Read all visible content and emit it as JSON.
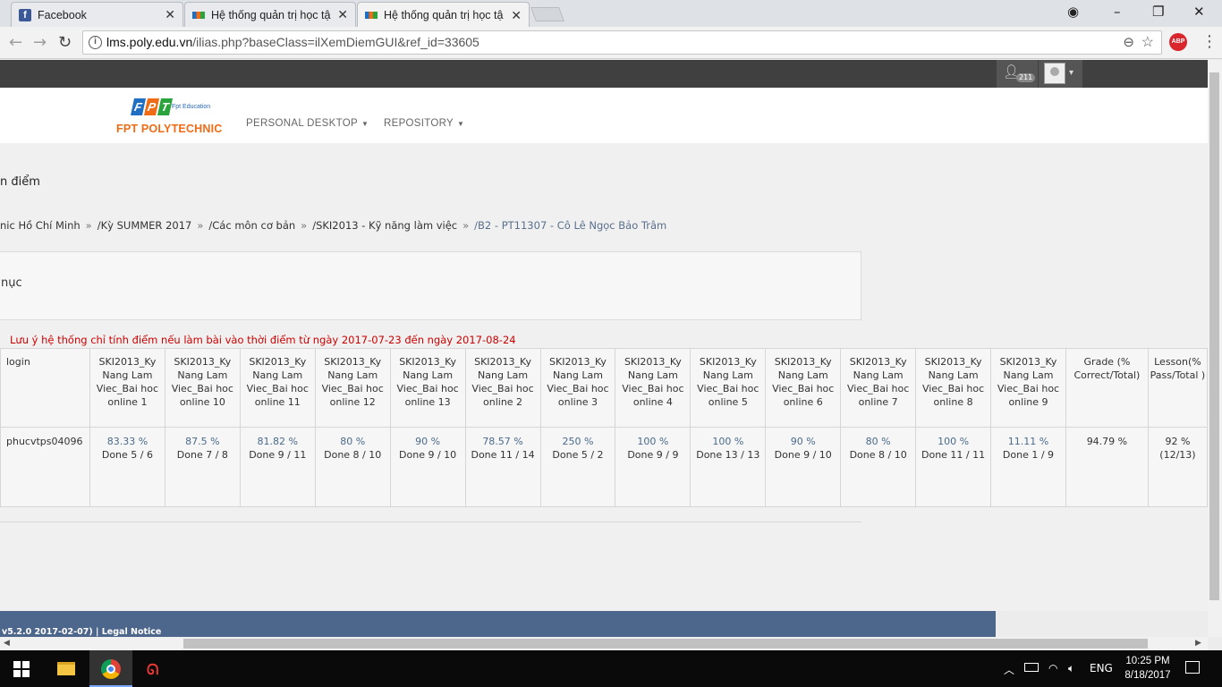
{
  "browser": {
    "tabs": [
      {
        "title": "Facebook",
        "icon": "facebook-icon",
        "active": false
      },
      {
        "title": "Hệ thống quản trị học tậ",
        "icon": "fpt-icon",
        "active": false
      },
      {
        "title": "Hệ thống quản trị học tậ",
        "icon": "fpt-icon",
        "active": true
      }
    ],
    "tab_close": "✕",
    "window_controls": {
      "profile": "◉",
      "minimize": "–",
      "restore": "❐",
      "close": "✕"
    },
    "nav": {
      "back": "←",
      "forward": "→",
      "reload": "↻"
    },
    "url_host": "lms.poly.edu.vn",
    "url_path": "/ilias.php?baseClass=ilXemDiemGUI&ref_id=33605",
    "zoom_icon": "⊖",
    "star_icon": "☆",
    "abp_label": "ABP",
    "menu": "⋮"
  },
  "topbar": {
    "user_count": "211",
    "caret": "▾"
  },
  "header": {
    "logo_letters": [
      "F",
      "P",
      "T"
    ],
    "logo_colors": [
      "#1e6fc4",
      "#ef6b15",
      "#2aa33c"
    ],
    "logo_edu": "Fpt Education",
    "logo_brand": "FPT POLYTECHNIC",
    "nav": [
      {
        "label": "PERSONAL DESKTOP"
      },
      {
        "label": "REPOSITORY"
      }
    ]
  },
  "page": {
    "title": "n điểm",
    "breadcrumb": [
      "nic Hồ Chí Minh",
      "/Kỳ SUMMER 2017",
      "/Các môn cơ bản",
      "/SKI2013 - Kỹ năng làm việc",
      "/B2 - PT11307 - Cô Lê Ngọc Bảo Trâm"
    ],
    "breadcrumb_sep": "»",
    "box_title": "nục",
    "notice": "Lưu ý hệ thống chỉ tính điểm nếu làm bài vào thời điểm từ ngày 2017-07-23 đến ngày 2017-08-24"
  },
  "table": {
    "login_header": "login",
    "columns": [
      "SKI2013_Ky Nang Lam Viec_Bai hoc online 1",
      "SKI2013_Ky Nang Lam Viec_Bai hoc online 10",
      "SKI2013_Ky Nang Lam Viec_Bai hoc online 11",
      "SKI2013_Ky Nang Lam Viec_Bai hoc online 12",
      "SKI2013_Ky Nang Lam Viec_Bai hoc online 13",
      "SKI2013_Ky Nang Lam Viec_Bai hoc online 2",
      "SKI2013_Ky Nang Lam Viec_Bai hoc online 3",
      "SKI2013_Ky Nang Lam Viec_Bai hoc online 4",
      "SKI2013_Ky Nang Lam Viec_Bai hoc online 5",
      "SKI2013_Ky Nang Lam Viec_Bai hoc online 6",
      "SKI2013_Ky Nang Lam Viec_Bai hoc online 7",
      "SKI2013_Ky Nang Lam Viec_Bai hoc online 8",
      "SKI2013_Ky Nang Lam Viec_Bai hoc online 9",
      "Grade (% Correct/Total)",
      "Lesson(% Pass/Total )"
    ],
    "row": {
      "login": "phucvtps04096",
      "cells": [
        {
          "pct": "83.33 %",
          "done": "Done 5 / 6"
        },
        {
          "pct": "87.5 %",
          "done": "Done 7 / 8"
        },
        {
          "pct": "81.82 %",
          "done": "Done 9 / 11"
        },
        {
          "pct": "80 %",
          "done": "Done 8 / 10"
        },
        {
          "pct": "90 %",
          "done": "Done 9 / 10"
        },
        {
          "pct": "78.57 %",
          "done": "Done 11 / 14"
        },
        {
          "pct": "250 %",
          "done": "Done 5 / 2"
        },
        {
          "pct": "100 %",
          "done": "Done 9 / 9"
        },
        {
          "pct": "100 %",
          "done": "Done 13 / 13"
        },
        {
          "pct": "90 %",
          "done": "Done 9 / 10"
        },
        {
          "pct": "80 %",
          "done": "Done 8 / 10"
        },
        {
          "pct": "100 %",
          "done": "Done 11 / 11"
        },
        {
          "pct": "11.11 %",
          "done": "Done 1 / 9"
        }
      ],
      "grade": "94.79 %",
      "lesson": "92 % (12/13)"
    }
  },
  "footer": {
    "text": "v5.2.0 2017-02-07) | Legal Notice"
  },
  "taskbar": {
    "tray": {
      "chevron": "︿",
      "lang": "ENG",
      "time": "10:25 PM",
      "date": "8/18/2017"
    }
  }
}
